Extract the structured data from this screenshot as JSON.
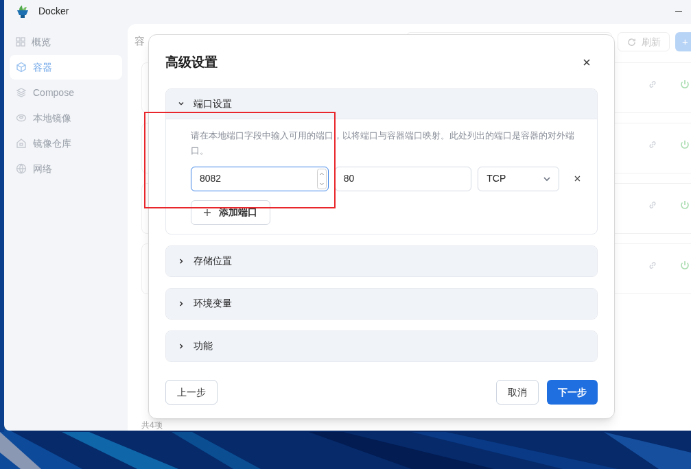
{
  "window": {
    "title": "Docker"
  },
  "sidebar": {
    "items": [
      {
        "label": "概览",
        "selected": false
      },
      {
        "label": "容器",
        "selected": true
      },
      {
        "label": "Compose",
        "selected": false
      },
      {
        "label": "本地镜像",
        "selected": false
      },
      {
        "label": "镜像仓库",
        "selected": false
      },
      {
        "label": "网络",
        "selected": false
      }
    ]
  },
  "background": {
    "heading": "容",
    "refresh_button": "刷新",
    "add_button": "+",
    "footer": "共4项"
  },
  "dialog": {
    "title": "高级设置",
    "sections": [
      {
        "title": "端口设置",
        "expanded": true,
        "description": "请在本地端口字段中输入可用的端口，以将端口与容器端口映射。此处列出的端口是容器的对外端口。",
        "ports": [
          {
            "local_port": "8082",
            "container_port": "80",
            "protocol": "TCP"
          }
        ],
        "add_button": "添加端口"
      },
      {
        "title": "存储位置",
        "expanded": false
      },
      {
        "title": "环境变量",
        "expanded": false
      },
      {
        "title": "功能",
        "expanded": false
      }
    ],
    "buttons": {
      "back": "上一步",
      "cancel": "取消",
      "next": "下一步"
    }
  },
  "annotation": {
    "kind": "highlight",
    "color": "#e8262b"
  }
}
